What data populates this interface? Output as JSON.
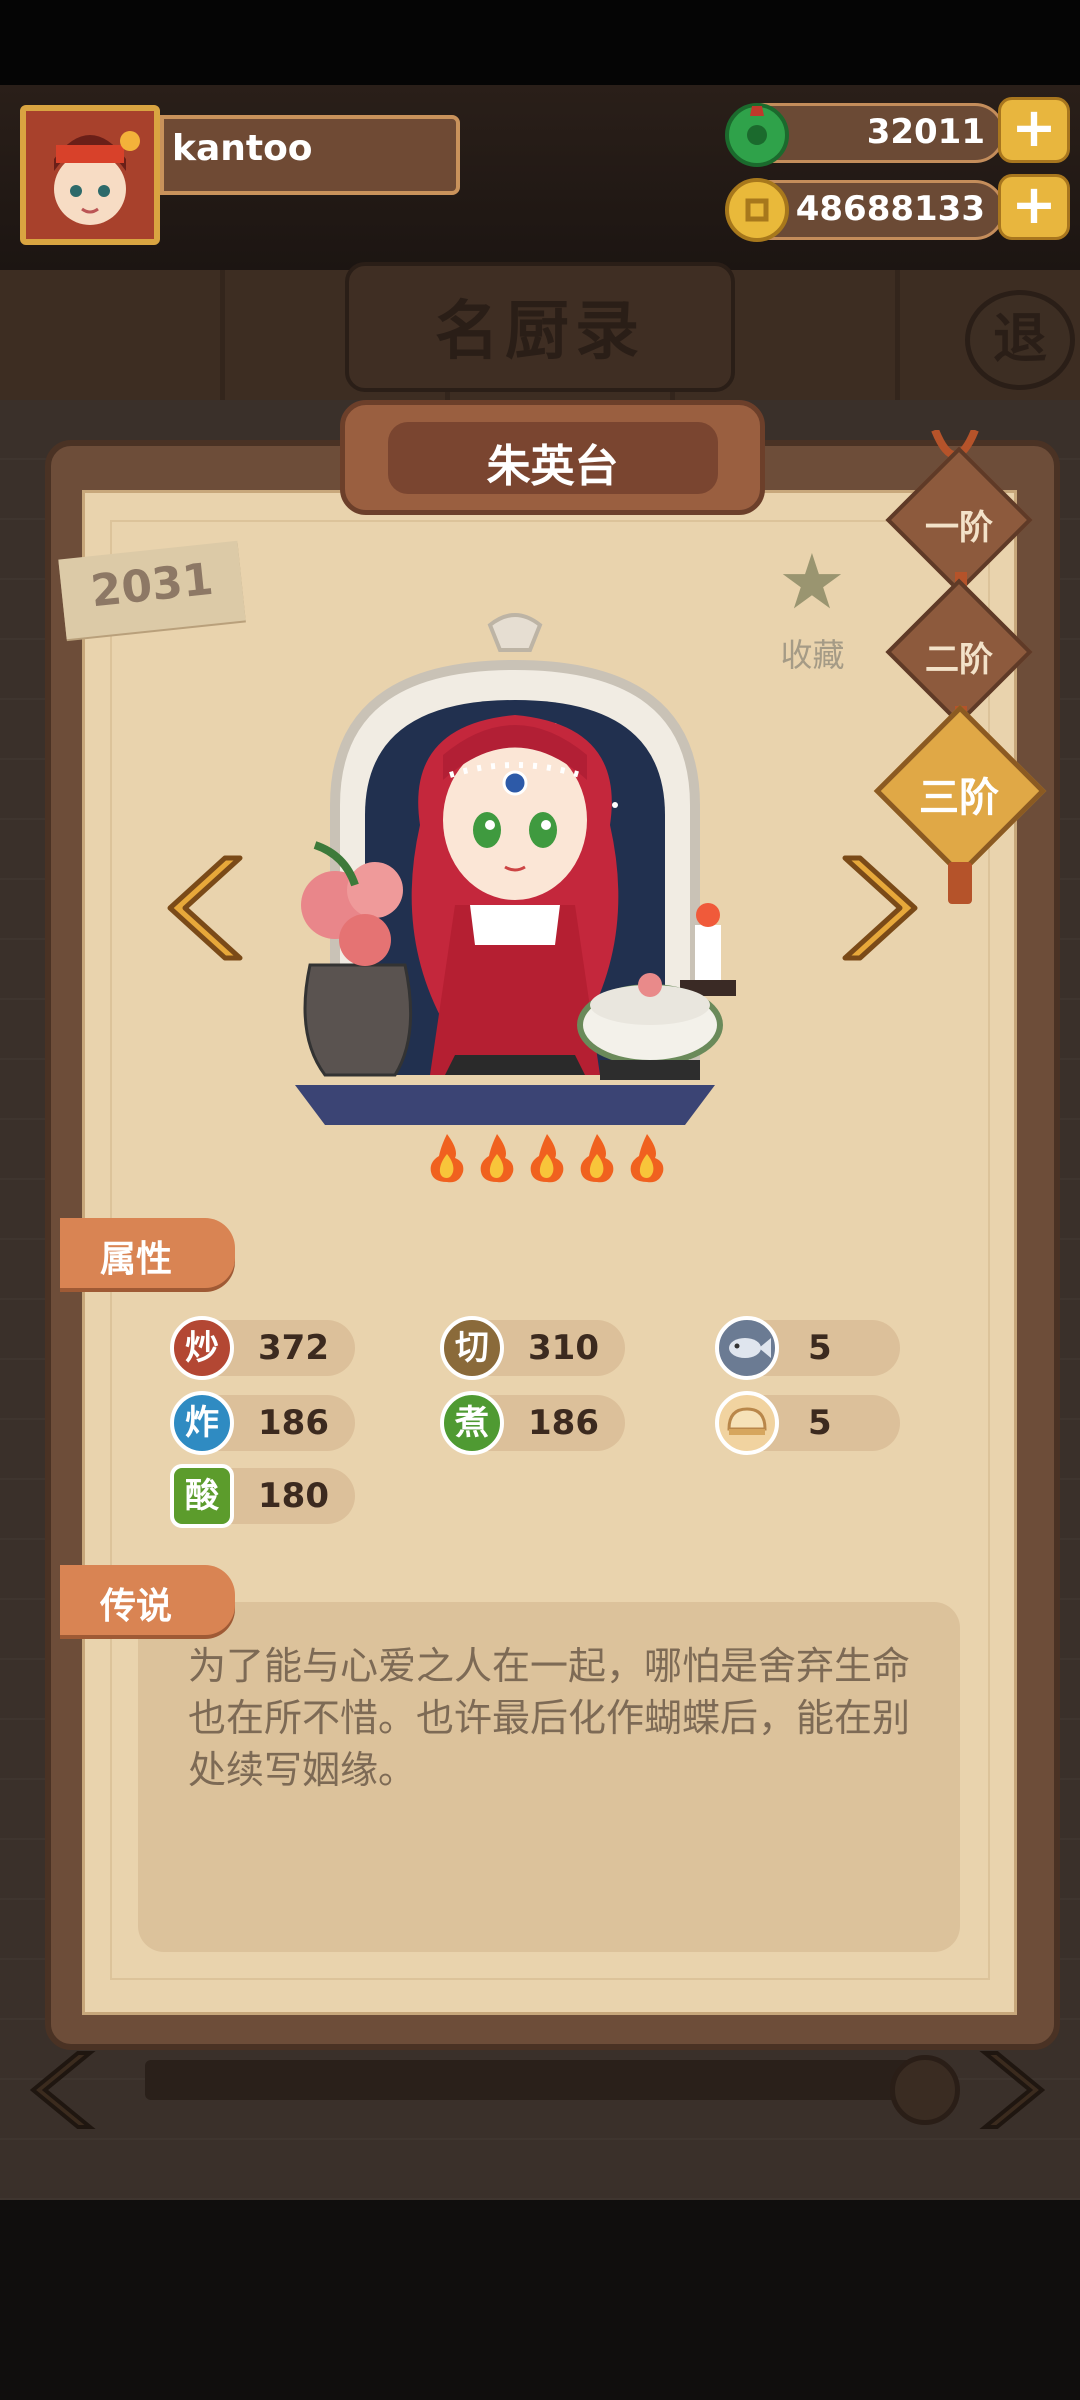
{
  "player": {
    "name": "kantoo"
  },
  "currency": {
    "jade": "32011",
    "coins": "48688133"
  },
  "screen": {
    "title": "名厨录",
    "exit_label": "退"
  },
  "chef": {
    "name": "朱英台",
    "id": "2031",
    "favorite_label": "收藏",
    "stars": 5
  },
  "ranks": [
    {
      "label": "一阶"
    },
    {
      "label": "二阶"
    },
    {
      "label": "三阶"
    }
  ],
  "attributes": {
    "heading": "属性",
    "items": [
      {
        "icon_text": "炒",
        "value": "372",
        "color": "#b34733"
      },
      {
        "icon_text": "切",
        "value": "310",
        "color": "#8a6a3a"
      },
      {
        "icon_text": "fish-icon",
        "value": "5",
        "color": "#6b7b93"
      },
      {
        "icon_text": "炸",
        "value": "186",
        "color": "#2f8bc2"
      },
      {
        "icon_text": "煮",
        "value": "186",
        "color": "#4f9a32"
      },
      {
        "icon_text": "bun-icon",
        "value": "5",
        "color": "#d6a65e"
      },
      {
        "icon_text": "酸",
        "value": "180",
        "color": "#5c9c2c"
      }
    ]
  },
  "legend": {
    "heading": "传说",
    "text": "为了能与心爱之人在一起，哪怕是舍弃生命也在所不惜。也许最后化作蝴蝶后，能在别处续写姻缘。"
  }
}
